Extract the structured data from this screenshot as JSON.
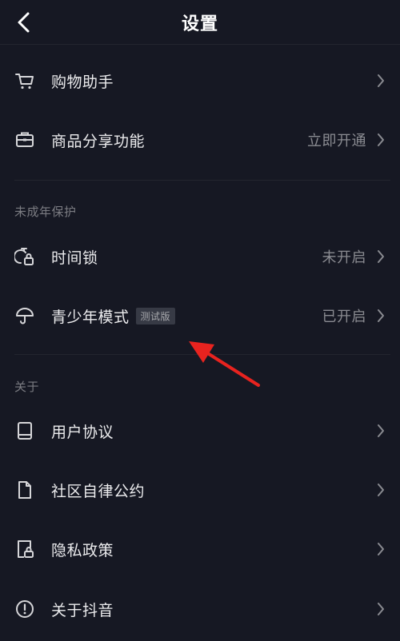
{
  "header": {
    "title": "设置"
  },
  "rows": {
    "shopping": {
      "label": "购物助手"
    },
    "share": {
      "label": "商品分享功能",
      "value": "立即开通"
    }
  },
  "sections": {
    "minor": {
      "title": "未成年保护",
      "time_lock": {
        "label": "时间锁",
        "value": "未开启"
      },
      "teen_mode": {
        "label": "青少年模式",
        "badge": "测试版",
        "value": "已开启"
      }
    },
    "about": {
      "title": "关于",
      "user_agreement": {
        "label": "用户协议"
      },
      "community": {
        "label": "社区自律公约"
      },
      "privacy": {
        "label": "隐私政策"
      },
      "about_app": {
        "label": "关于抖音"
      }
    }
  },
  "colors": {
    "background": "#161823",
    "annotation_arrow": "#e8231f"
  },
  "icons": {
    "back": "chevron-left-icon",
    "shopping": "cart-icon",
    "share": "briefcase-icon",
    "time_lock": "timer-lock-icon",
    "teen_mode": "umbrella-icon",
    "user_agreement": "book-icon",
    "community": "document-icon",
    "privacy": "file-lock-icon",
    "about_app": "info-alert-icon"
  }
}
